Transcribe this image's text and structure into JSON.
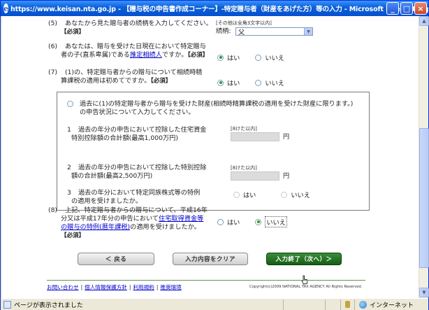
{
  "window": {
    "title": "https://www.keisan.nta.go.jp - 【贈与税の申告書作成コーナー】-特定贈与者（財産をあげた方）等の入力 - Microsoft Internet Explorer",
    "icon": "ie-icon",
    "controls": [
      "minimize-icon",
      "maximize-icon",
      "close-icon"
    ]
  },
  "q5": {
    "num": "(5)",
    "text": "あなたから見た贈与者の続柄を入力してください。",
    "required": "【必須】",
    "hint": "[その他は全角3文字以内]",
    "select_label": "続柄:",
    "select_value": "父"
  },
  "q6": {
    "num": "(6)",
    "text1": "あなたは、贈与を受けた日現在において特定贈与",
    "text2_pre": "者の子(直系卑属)である",
    "text2_link": "推定相続人",
    "text2_post": "ですか。",
    "required": "【必須】",
    "yes": "はい",
    "no": "いいえ"
  },
  "q7": {
    "num": "(7)",
    "text1": "(1)の、特定贈与者からの贈与について相続時精",
    "text2": "算課税の適用は初めてですか。",
    "required": "【必須】",
    "yes": "はい",
    "no": "いいえ"
  },
  "box": {
    "intro1": "過去に(1)の特定贈与者から贈与を受けた財産(相続時精算課税の適用を受けた財産に限ります。)",
    "intro2": "の申告状況について入力してください。",
    "item1": {
      "num": "1",
      "text1": "過去の年分の申告において控除した住宅資金",
      "text2": "特別控除額の合計額(最高1,000万円)",
      "hint": "[8けた以内]",
      "unit": "円"
    },
    "item2": {
      "num": "2",
      "text1": "過去の年分の申告において控除した特別控除",
      "text2": "額の合計額(最高2,500万円)",
      "hint": "[8けた以内]",
      "unit": "円"
    },
    "item3": {
      "num": "3",
      "text1": "過去の年分において特定同族株式等の特例",
      "text2": "の適用を受けましたか。",
      "yes": "はい",
      "no": "いいえ"
    }
  },
  "q8": {
    "num": "(8)",
    "text1": "上記、特定贈与者からの贈与について、平成16年",
    "text2_pre": "分又は平成17年分の申告において",
    "text2_link": "住宅取得資金等",
    "text3_link": "の贈与の特例(暦年課税)",
    "text3_post": "の適用を受けましたか。",
    "required": "【必須】",
    "yes": "はい",
    "no": "いいえ"
  },
  "buttons": {
    "back": "＜ 戻る",
    "clear": "入力内容をクリア",
    "next": "入力終了（次へ）＞"
  },
  "footer": {
    "links": [
      "お問い合わせ",
      "個人情報保護方針",
      "利用規約",
      "推奨環境"
    ],
    "separators": [
      "|",
      "|",
      "|"
    ],
    "copyright": "Copyright(c)2009 NATIONAL TAX AGENCY All Rights Reserved."
  },
  "statusbar": {
    "text": "ページが表示されました",
    "zone": "インターネット"
  }
}
